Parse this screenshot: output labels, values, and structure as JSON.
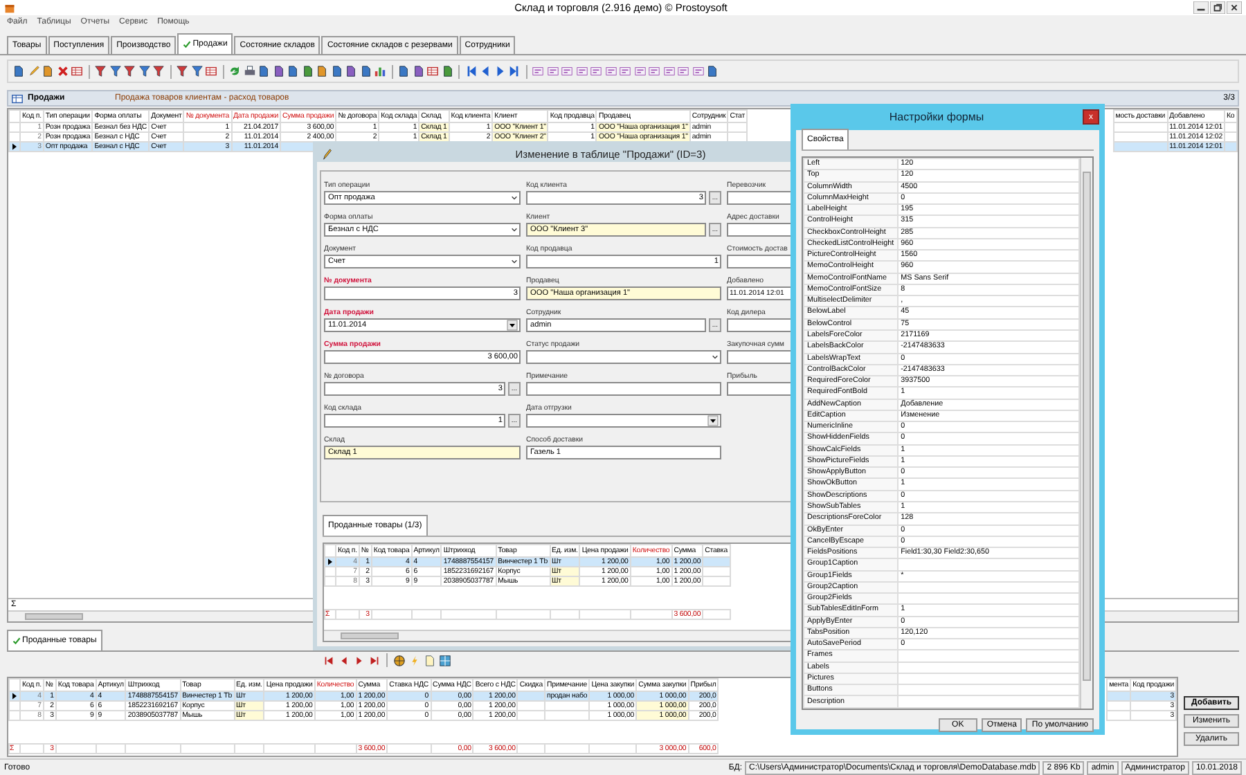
{
  "window": {
    "title": "Склад и торговля (2.916 демо) © Prostoysoft"
  },
  "menu": [
    "Файл",
    "Таблицы",
    "Отчеты",
    "Сервис",
    "Помощь"
  ],
  "tabs": [
    {
      "label": "Товары",
      "selected": false,
      "checked": false
    },
    {
      "label": "Поступления",
      "selected": false,
      "checked": false
    },
    {
      "label": "Производство",
      "selected": false,
      "checked": false
    },
    {
      "label": "Продажи",
      "selected": true,
      "checked": true
    },
    {
      "label": "Состояние складов",
      "selected": false,
      "checked": false
    },
    {
      "label": "Состояние складов с резервами",
      "selected": false,
      "checked": false
    },
    {
      "label": "Сотрудники",
      "selected": false,
      "checked": false
    }
  ],
  "panel": {
    "title": "Продажи",
    "subtitle": "Продажа товаров клиентам - расход товаров",
    "counter": "3/3"
  },
  "main_grid": {
    "columns": [
      {
        "label": "Код п.",
        "kind": "key",
        "required": false
      },
      {
        "label": "Тип операции",
        "kind": "text",
        "required": false
      },
      {
        "label": "Форма оплаты",
        "kind": "text",
        "required": false
      },
      {
        "label": "Документ",
        "kind": "text",
        "required": false
      },
      {
        "label": "№ документа",
        "kind": "number",
        "required": true
      },
      {
        "label": "Дата продажи",
        "kind": "number",
        "required": true
      },
      {
        "label": "Сумма продажи",
        "kind": "number",
        "required": true
      },
      {
        "label": "№ договора",
        "kind": "number",
        "required": false
      },
      {
        "label": "Код склада",
        "kind": "number",
        "required": false
      },
      {
        "label": "Склад",
        "kind": "lookup",
        "required": false
      },
      {
        "label": "Код клиента",
        "kind": "number",
        "required": false
      },
      {
        "label": "Клиент",
        "kind": "lookup",
        "required": false
      },
      {
        "label": "Код продавца",
        "kind": "number",
        "required": false
      },
      {
        "label": "Продавец",
        "kind": "lookup",
        "required": false
      },
      {
        "label": "Сотрудник",
        "kind": "text",
        "required": false
      },
      {
        "label": "Стат",
        "kind": "text",
        "required": false
      }
    ],
    "right_columns": [
      {
        "label": "мость доставки",
        "required": false
      },
      {
        "label": "Добавлено",
        "required": false,
        "values": [
          "11.01.2014 12:01",
          "11.01.2014 12:02",
          "11.01.2014 12:01"
        ]
      },
      {
        "label": "Ко",
        "required": false
      }
    ],
    "rows": [
      {
        "selected": false,
        "cells": [
          "1",
          "Розн продажа",
          "Безнал без НДС",
          "Счет",
          "1",
          "21.04.2017",
          "3 600,00",
          "1",
          "1",
          "Склад 1",
          "1",
          "ООО \"Клиент 1\"",
          "1",
          "ООО \"Наша организация 1\"",
          "admin"
        ]
      },
      {
        "selected": false,
        "cells": [
          "2",
          "Розн продажа",
          "Безнал с НДС",
          "Счет",
          "2",
          "11.01.2014",
          "2 400,00",
          "2",
          "1",
          "Склад 1",
          "2",
          "ООО \"Клиент 2\"",
          "1",
          "ООО \"Наша организация 1\"",
          "admin"
        ]
      },
      {
        "selected": true,
        "cells": [
          "3",
          "Опт продажа",
          "Безнал с НДС",
          "Счет",
          "3",
          "11.01.2014"
        ]
      }
    ],
    "sum_sign": "Σ"
  },
  "edit_dialog": {
    "title": "Изменение в таблице \"Продажи\" (ID=3)",
    "form": [
      {
        "fields": [
          {
            "label": "Тип операции",
            "value": "Опт продажа",
            "kind": "combo",
            "required": false,
            "lookup": false
          },
          {
            "label": "Форма оплаты",
            "value": "Безнал с НДС",
            "kind": "combo",
            "required": false,
            "lookup": false
          },
          {
            "label": "Документ",
            "value": "Счет",
            "kind": "combo",
            "required": false,
            "lookup": false
          },
          {
            "label": "№ документа",
            "value": "3",
            "kind": "number",
            "required": true,
            "lookup": false
          },
          {
            "label": "Дата продажи",
            "value": "11.01.2014",
            "kind": "date",
            "required": true,
            "lookup": false
          },
          {
            "label": "Сумма продажи",
            "value": "3 600,00",
            "kind": "number",
            "required": true,
            "lookup": false
          },
          {
            "label": "№ договора",
            "value": "3",
            "kind": "number",
            "required": false,
            "lookup": false,
            "button": "..."
          },
          {
            "label": "Код склада",
            "value": "1",
            "kind": "number",
            "required": false,
            "lookup": false,
            "button": "..."
          },
          {
            "label": "Склад",
            "value": "Склад 1",
            "kind": "text",
            "required": false,
            "lookup": true
          }
        ]
      },
      {
        "fields": [
          {
            "label": "Код клиента",
            "value": "3",
            "kind": "number",
            "required": false,
            "lookup": false,
            "button": "..."
          },
          {
            "label": "Клиент",
            "value": "ООО \"Клиент 3\"",
            "kind": "text",
            "required": false,
            "lookup": true,
            "button": "..."
          },
          {
            "label": "Код продавца",
            "value": "1",
            "kind": "number",
            "required": false,
            "lookup": false
          },
          {
            "label": "Продавец",
            "value": "ООО \"Наша организация 1\"",
            "kind": "text",
            "required": false,
            "lookup": true
          },
          {
            "label": "Сотрудник",
            "value": "admin",
            "kind": "text",
            "required": false,
            "lookup": false,
            "button": "..."
          },
          {
            "label": "Статус продажи",
            "kind": "combo",
            "required": false,
            "lookup": false
          },
          {
            "label": "Примечание",
            "kind": "text",
            "required": false,
            "lookup": false
          },
          {
            "label": "Дата отгрузки",
            "kind": "date",
            "required": false,
            "lookup": false
          },
          {
            "label": "Способ доставки",
            "value": "Газель 1",
            "kind": "text",
            "required": false,
            "lookup": false
          }
        ]
      },
      {
        "fields": [
          {
            "label": "Перевозчик",
            "kind": "text",
            "required": false,
            "lookup": false
          },
          {
            "label": "Адрес доставки",
            "kind": "text",
            "required": false,
            "lookup": false
          },
          {
            "label": "Стоимость достав",
            "kind": "number",
            "required": false,
            "lookup": false
          },
          {
            "label": "Добавлено",
            "value": "11.01.2014 12:01",
            "kind": "text",
            "required": false,
            "lookup": false
          },
          {
            "label": "Код дилера",
            "kind": "text",
            "required": false,
            "lookup": false
          },
          {
            "label": "Закупочная сумм",
            "kind": "number",
            "required": false,
            "lookup": false
          },
          {
            "label": "Прибыль",
            "kind": "number",
            "required": false,
            "lookup": false
          }
        ]
      }
    ],
    "subtab": "Проданные товары (1/3)",
    "grid": {
      "columns": [
        {
          "label": "Код п.",
          "kind": "key",
          "required": false
        },
        {
          "label": "№",
          "kind": "number",
          "required": false,
          "total": "3"
        },
        {
          "label": "Код товара",
          "kind": "number",
          "required": false
        },
        {
          "label": "Артикул",
          "kind": "text",
          "required": false
        },
        {
          "label": "Штрихкод",
          "kind": "text",
          "required": false
        },
        {
          "label": "Товар",
          "kind": "text",
          "required": false
        },
        {
          "label": "Ед. изм.",
          "kind": "lookup",
          "required": false
        },
        {
          "label": "Цена продажи",
          "kind": "number",
          "required": false
        },
        {
          "label": "Количество",
          "kind": "number",
          "required": true
        },
        {
          "label": "Сумма",
          "kind": "number",
          "required": false,
          "total": "3 600,00"
        },
        {
          "label": "Ставка",
          "kind": "number",
          "required": false
        }
      ],
      "rows": [
        {
          "selected": true,
          "cells": [
            "4",
            "1",
            "4",
            "4",
            "1748887554157",
            "Винчестер 1 Tb",
            "Шт",
            "1 200,00",
            "1,00",
            "1 200,00"
          ]
        },
        {
          "selected": false,
          "cells": [
            "7",
            "2",
            "6",
            "6",
            "1852231692167",
            "Корпус",
            "Шт",
            "1 200,00",
            "1,00",
            "1 200,00"
          ]
        },
        {
          "selected": false,
          "cells": [
            "8",
            "3",
            "9",
            "9",
            "2038905037787",
            "Мышь",
            "Шт",
            "1 200,00",
            "1,00",
            "1 200,00"
          ]
        }
      ],
      "sum_sign": "Σ"
    }
  },
  "settings_dialog": {
    "title": "Настройки формы",
    "tab": "Свойства",
    "properties": [
      {
        "name": "Left",
        "value": "120"
      },
      {
        "name": "Top",
        "value": "120"
      },
      {
        "name": "ColumnWidth",
        "value": "4500"
      },
      {
        "name": "ColumnMaxHeight",
        "value": "0"
      },
      {
        "name": "LabelHeight",
        "value": "195"
      },
      {
        "name": "ControlHeight",
        "value": "315"
      },
      {
        "name": "CheckboxControlHeight",
        "value": "285"
      },
      {
        "name": "CheckedListControlHeight",
        "value": "960"
      },
      {
        "name": "PictureControlHeight",
        "value": "1560"
      },
      {
        "name": "MemoControlHeight",
        "value": "960"
      },
      {
        "name": "MemoControlFontName",
        "value": "MS Sans Serif"
      },
      {
        "name": "MemoControlFontSize",
        "value": "8"
      },
      {
        "name": "MultiselectDelimiter",
        "value": ","
      },
      {
        "name": "BelowLabel",
        "value": "45"
      },
      {
        "name": "BelowControl",
        "value": "75"
      },
      {
        "name": "LabelsForeColor",
        "value": "2171169"
      },
      {
        "name": "LabelsBackColor",
        "value": "-2147483633"
      },
      {
        "name": "LabelsWrapText",
        "value": "0"
      },
      {
        "name": "ControlBackColor",
        "value": "-2147483633"
      },
      {
        "name": "RequiredForeColor",
        "value": "3937500"
      },
      {
        "name": "RequiredFontBold",
        "value": "1"
      },
      {
        "name": "AddNewCaption",
        "value": "Добавление"
      },
      {
        "name": "EditCaption",
        "value": "Изменение"
      },
      {
        "name": "NumericInline",
        "value": "0"
      },
      {
        "name": "ShowHiddenFields",
        "value": "0"
      },
      {
        "name": "ShowCalcFields",
        "value": "1"
      },
      {
        "name": "ShowPictureFields",
        "value": "1"
      },
      {
        "name": "ShowApplyButton",
        "value": "0"
      },
      {
        "name": "ShowOkButton",
        "value": "1"
      },
      {
        "name": "ShowDescriptions",
        "value": "0"
      },
      {
        "name": "ShowSubTables",
        "value": "1"
      },
      {
        "name": "DescriptionsForeColor",
        "value": "128"
      },
      {
        "name": "OkByEnter",
        "value": "0"
      },
      {
        "name": "CancelByEscape",
        "value": "0"
      },
      {
        "name": "FieldsPositions",
        "value": "Field1:30,30 Field2:30,650"
      },
      {
        "name": "Group1Caption"
      },
      {
        "name": "Group1Fields",
        "value": "*"
      },
      {
        "name": "Group2Caption"
      },
      {
        "name": "Group2Fields"
      },
      {
        "name": "SubTablesEditInForm",
        "value": "1"
      },
      {
        "name": "ApplyByEnter",
        "value": "0"
      },
      {
        "name": "TabsPosition",
        "value": "120,120"
      },
      {
        "name": "AutoSavePeriod",
        "value": "0"
      },
      {
        "name": "Frames"
      },
      {
        "name": "Labels"
      },
      {
        "name": "Pictures"
      },
      {
        "name": "Buttons"
      },
      {
        "name": "Description"
      }
    ],
    "close": "x",
    "buttons": [
      "OK",
      "Отмена",
      "По умолчанию"
    ]
  },
  "bottom": {
    "tab": {
      "label": "Проданные товары",
      "checked": true
    },
    "grid": {
      "columns": [
        {
          "label": "Код п.",
          "kind": "key",
          "required": false
        },
        {
          "label": "№",
          "kind": "number",
          "required": false,
          "total": "3"
        },
        {
          "label": "Код товара",
          "kind": "number",
          "required": false
        },
        {
          "label": "Артикул",
          "kind": "text",
          "required": false
        },
        {
          "label": "Штрихкод",
          "kind": "text",
          "required": false
        },
        {
          "label": "Товар",
          "kind": "text",
          "required": false
        },
        {
          "label": "Ед. изм.",
          "kind": "lookup",
          "required": false
        },
        {
          "label": "Цена продажи",
          "kind": "number",
          "required": false
        },
        {
          "label": "Количество",
          "kind": "number",
          "required": true
        },
        {
          "label": "Сумма",
          "kind": "number",
          "required": false,
          "total": "3 600,00"
        },
        {
          "label": "Ставка НДС",
          "kind": "number",
          "required": false
        },
        {
          "label": "Сумма НДС",
          "kind": "number",
          "required": false,
          "total": "0,00"
        },
        {
          "label": "Всего с НДС",
          "kind": "number",
          "required": false,
          "total": "3 600,00"
        },
        {
          "label": "Скидка",
          "kind": "number",
          "required": false
        },
        {
          "label": "Примечание",
          "kind": "text",
          "required": false
        },
        {
          "label": "Цена закупки",
          "kind": "number",
          "required": false
        },
        {
          "label": "Сумма закупки",
          "kind": "calc",
          "required": false,
          "total": "3 000,00"
        },
        {
          "label": "Прибыл",
          "kind": "number",
          "required": false,
          "total": "600,0"
        }
      ],
      "right_columns": [
        {
          "label": "мента",
          "required": false
        },
        {
          "label": "Код продажи",
          "kind": "number",
          "required": false,
          "values": [
            "3",
            "3",
            "3"
          ]
        }
      ],
      "rows": [
        {
          "selected": true,
          "cells": [
            "4",
            "1",
            "4",
            "4",
            "1748887554157",
            "Винчестер 1 Tb",
            "Шт",
            "1 200,00",
            "1,00",
            "1 200,00",
            "0",
            "0,00",
            "1 200,00",
            "",
            "продан набо",
            "1 000,00",
            "1 000,00",
            "200,0"
          ]
        },
        {
          "selected": false,
          "cells": [
            "7",
            "2",
            "6",
            "6",
            "1852231692167",
            "Корпус",
            "Шт",
            "1 200,00",
            "1,00",
            "1 200,00",
            "0",
            "0,00",
            "1 200,00",
            "",
            "",
            "1 000,00",
            "1 000,00",
            "200,0"
          ]
        },
        {
          "selected": false,
          "cells": [
            "8",
            "3",
            "9",
            "9",
            "2038905037787",
            "Мышь",
            "Шт",
            "1 200,00",
            "1,00",
            "1 200,00",
            "0",
            "0,00",
            "1 200,00",
            "",
            "",
            "1 000,00",
            "1 000,00",
            "200,0"
          ]
        }
      ],
      "sum_sign": "Σ"
    },
    "buttons": [
      {
        "label": "Добавить",
        "default": true
      },
      {
        "label": "Изменить",
        "default": false
      },
      {
        "label": "Удалить",
        "default": false
      }
    ]
  },
  "status_bar": {
    "left": "Готово",
    "db_label": "БД:",
    "segments": [
      "C:\\Users\\Администратор\\Documents\\Склад и торговля\\DemoDatabase.mdb",
      "2 896 Kb",
      "admin",
      "Администратор",
      "10.01.2018"
    ]
  }
}
